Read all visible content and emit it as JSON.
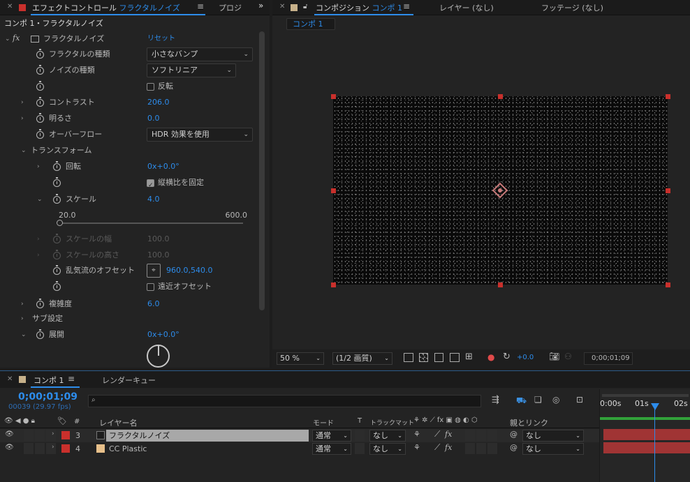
{
  "effect_controls": {
    "tab_label": "エフェクトコントロール",
    "tab_target": "フラクタルノイズ",
    "tab_other": "プロジ",
    "breadcrumb": "コンポ 1・フラクタルノイズ",
    "effect_name": "フラクタルノイズ",
    "reset_label": "リセット",
    "fx_label": "fx",
    "properties": [
      {
        "label": "フラクタルの種類",
        "value": "小さなバンプ"
      },
      {
        "label": "ノイズの種類",
        "value": "ソフトリニア"
      },
      {
        "label": "",
        "value": "反転"
      },
      {
        "label": "コントラスト",
        "value": "206.0"
      },
      {
        "label": "明るさ",
        "value": "0.0"
      },
      {
        "label": "オーバーフロー",
        "value": "HDR 効果を使用"
      },
      {
        "label": "トランスフォーム",
        "value": ""
      },
      {
        "label": "回転",
        "value": "0x+0.0°"
      },
      {
        "label": "",
        "value": "縦横比を固定"
      },
      {
        "label": "スケール",
        "value": "4.0"
      },
      {
        "label": "スケールの幅",
        "value": "100.0"
      },
      {
        "label": "スケールの高さ",
        "value": "100.0"
      },
      {
        "label": "乱気流のオフセット",
        "value": "960.0,540.0"
      },
      {
        "label": "",
        "value": "遠近オフセット"
      },
      {
        "label": "複雑度",
        "value": "6.0"
      },
      {
        "label": "サブ設定",
        "value": ""
      },
      {
        "label": "展開",
        "value": "0x+0.0°"
      }
    ],
    "scale_slider": {
      "min": "20.0",
      "max": "600.0",
      "fraction": 0.0
    }
  },
  "composition": {
    "tab_label": "コンポジション",
    "tab_target": "コンポ 1",
    "layer_tab": "レイヤー (なし)",
    "footage_tab": "フッテージ (なし)",
    "comp_chip": "コンポ 1",
    "zoom": "50 %",
    "resolution": "(1/2 画質)",
    "exposure": "+0.0",
    "timecode": "0;00;01;09"
  },
  "timeline": {
    "tab_label": "コンポ 1",
    "render_tab": "レンダーキュー",
    "timecode": "0;00;01;09",
    "frames": "00039 (29.97 fps)",
    "search_placeholder": "",
    "headers": {
      "layer_name": "レイヤー名",
      "mode": "モード",
      "t": "T",
      "trackmatte": "トラックマット",
      "parent": "親とリンク",
      "num": "#"
    },
    "ruler": [
      "0:00s",
      "01s",
      "02s"
    ],
    "layers": [
      {
        "num": "3",
        "name": "フラクタルノイズ",
        "mode": "通常",
        "matte": "なし",
        "parent": "なし",
        "color": "#c9302c",
        "swatch": "#1e1e1e"
      },
      {
        "num": "4",
        "name": "CC Plastic",
        "mode": "通常",
        "matte": "なし",
        "parent": "なし",
        "color": "#c9302c",
        "swatch": "#e8c08a"
      }
    ]
  }
}
